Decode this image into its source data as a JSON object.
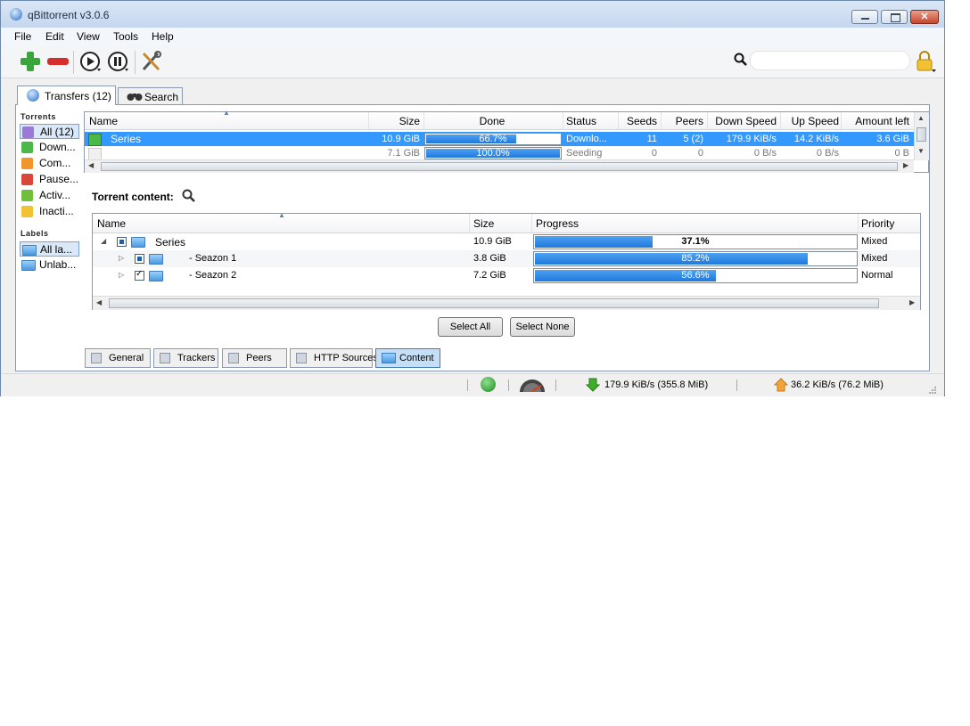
{
  "window": {
    "title": "qBittorrent v3.0.6"
  },
  "menu": [
    "File",
    "Edit",
    "View",
    "Tools",
    "Help"
  ],
  "toolbar": {
    "icons": [
      "add-torrent-icon",
      "remove-torrent-icon",
      "resume-icon",
      "pause-icon",
      "options-icon",
      "search-icon",
      "lock-icon"
    ],
    "search_placeholder": ""
  },
  "top_tabs": [
    {
      "label": "Transfers (12)",
      "icon": "transfers-icon"
    },
    {
      "label": "Search",
      "icon": "binoculars-icon"
    }
  ],
  "sidebar": {
    "torrents_heading": "Torrents",
    "torrents": [
      {
        "label": "All (12)",
        "color": "#9a7ad6",
        "selected": true
      },
      {
        "label": "Down...",
        "color": "#4db84a"
      },
      {
        "label": "Com...",
        "color": "#f0962c"
      },
      {
        "label": "Pause...",
        "color": "#d9473a"
      },
      {
        "label": "Activ...",
        "color": "#6fbf3d"
      },
      {
        "label": "Inacti...",
        "color": "#f1c232"
      }
    ],
    "labels_heading": "Labels",
    "labels": [
      {
        "label": "All la...",
        "selected": true
      },
      {
        "label": "Unlab..."
      }
    ]
  },
  "transfers": {
    "columns": [
      "Name",
      "Size",
      "Done",
      "Status",
      "Seeds",
      "Peers",
      "Down Speed",
      "Up Speed",
      "Amount left"
    ],
    "rows": [
      {
        "name": "Series",
        "size": "10.9 GiB",
        "done": "66.7%",
        "done_value": 0.667,
        "status": "Downlo...",
        "seeds": "11",
        "peers": "5 (2)",
        "down": "179.9 KiB/s",
        "up": "14.2 KiB/s",
        "left": "3.6 GiB",
        "selected": true
      },
      {
        "name": "",
        "size": "7.1 GiB",
        "done": "100.0%",
        "done_value": 1.0,
        "status": "Seeding",
        "seeds": "0",
        "peers": "0",
        "down": "0 B/s",
        "up": "0 B/s",
        "left": "0 B"
      }
    ]
  },
  "content": {
    "label": "Torrent content:",
    "columns": [
      "Name",
      "Size",
      "Progress",
      "Priority"
    ],
    "rows": [
      {
        "name": "Series",
        "size": "10.9 GiB",
        "progress": "37.1%",
        "progress_value": 0.371,
        "priority": "Mixed",
        "check": "partial"
      },
      {
        "name": "- Seazon 1",
        "size": "3.8 GiB",
        "progress": "85.2%",
        "progress_value": 0.852,
        "priority": "Mixed",
        "check": "partial"
      },
      {
        "name": "- Seazon 2",
        "size": "7.2 GiB",
        "progress": "56.6%",
        "progress_value": 0.566,
        "priority": "Normal",
        "check": "checked"
      }
    ],
    "select_all": "Select All",
    "select_none": "Select None"
  },
  "bottom_tabs": [
    {
      "label": "General",
      "icon": "general-icon"
    },
    {
      "label": "Trackers",
      "icon": "trackers-icon"
    },
    {
      "label": "Peers",
      "icon": "peers-icon"
    },
    {
      "label": "HTTP Sources",
      "icon": "http-sources-icon"
    },
    {
      "label": "Content",
      "icon": "content-icon",
      "active": true
    }
  ],
  "statusbar": {
    "download": "179.9 KiB/s (355.8 MiB)",
    "upload": "36.2 KiB/s (76.2 MiB)"
  }
}
